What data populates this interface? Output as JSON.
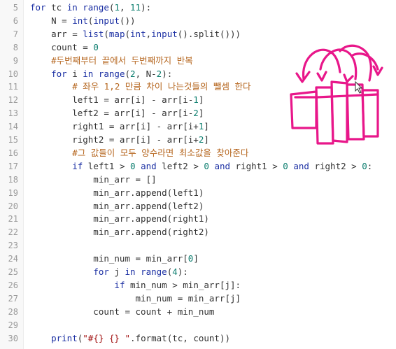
{
  "editor": {
    "language": "python",
    "accent_colors": {
      "keyword": "#1b2fa3",
      "number": "#0b7d6e",
      "string": "#a31515",
      "comment": "#b5651d",
      "annotation_ink": "#e8178a"
    },
    "lines": [
      {
        "n": "5",
        "tokens": [
          [
            "kw",
            "for"
          ],
          [
            "op",
            " tc "
          ],
          [
            "kw",
            "in"
          ],
          [
            "op",
            " "
          ],
          [
            "bi",
            "range"
          ],
          [
            "op",
            "("
          ],
          [
            "num",
            "1"
          ],
          [
            "op",
            ", "
          ],
          [
            "num",
            "11"
          ],
          [
            "op",
            "):"
          ]
        ]
      },
      {
        "n": "6",
        "tokens": [
          [
            "op",
            "    N = "
          ],
          [
            "bi",
            "int"
          ],
          [
            "op",
            "("
          ],
          [
            "bi",
            "input"
          ],
          [
            "op",
            "())"
          ]
        ]
      },
      {
        "n": "7",
        "tokens": [
          [
            "op",
            "    arr = "
          ],
          [
            "bi",
            "list"
          ],
          [
            "op",
            "("
          ],
          [
            "bi",
            "map"
          ],
          [
            "op",
            "("
          ],
          [
            "bi",
            "int"
          ],
          [
            "op",
            ","
          ],
          [
            "bi",
            "input"
          ],
          [
            "op",
            "().split()))"
          ]
        ]
      },
      {
        "n": "8",
        "tokens": [
          [
            "op",
            "    count = "
          ],
          [
            "num",
            "0"
          ]
        ]
      },
      {
        "n": "9",
        "tokens": [
          [
            "cm",
            "    #두번째부터 끝에서 두번째까지 반복"
          ]
        ]
      },
      {
        "n": "10",
        "tokens": [
          [
            "op",
            "    "
          ],
          [
            "kw",
            "for"
          ],
          [
            "op",
            " i "
          ],
          [
            "kw",
            "in"
          ],
          [
            "op",
            " "
          ],
          [
            "bi",
            "range"
          ],
          [
            "op",
            "("
          ],
          [
            "num",
            "2"
          ],
          [
            "op",
            ", N-"
          ],
          [
            "num",
            "2"
          ],
          [
            "op",
            "):"
          ]
        ]
      },
      {
        "n": "11",
        "tokens": [
          [
            "cm",
            "        # 좌우 1,2 만큼 차이 나는것들의 뺄셈 한다"
          ]
        ]
      },
      {
        "n": "12",
        "tokens": [
          [
            "op",
            "        left1 = arr[i] - arr[i-"
          ],
          [
            "num",
            "1"
          ],
          [
            "op",
            "]"
          ]
        ]
      },
      {
        "n": "13",
        "tokens": [
          [
            "op",
            "        left2 = arr[i] - arr[i-"
          ],
          [
            "num",
            "2"
          ],
          [
            "op",
            "]"
          ]
        ]
      },
      {
        "n": "14",
        "tokens": [
          [
            "op",
            "        right1 = arr[i] - arr[i+"
          ],
          [
            "num",
            "1"
          ],
          [
            "op",
            "]"
          ]
        ]
      },
      {
        "n": "15",
        "tokens": [
          [
            "op",
            "        right2 = arr[i] - arr[i+"
          ],
          [
            "num",
            "2"
          ],
          [
            "op",
            "]"
          ]
        ]
      },
      {
        "n": "16",
        "tokens": [
          [
            "cm",
            "        #그 값들이 모두 양수라면 최소값을 찾아준다"
          ]
        ]
      },
      {
        "n": "17",
        "tokens": [
          [
            "op",
            "        "
          ],
          [
            "kw",
            "if"
          ],
          [
            "op",
            " left1 > "
          ],
          [
            "num",
            "0"
          ],
          [
            "op",
            " "
          ],
          [
            "kw",
            "and"
          ],
          [
            "op",
            " left2 > "
          ],
          [
            "num",
            "0"
          ],
          [
            "op",
            " "
          ],
          [
            "kw",
            "and"
          ],
          [
            "op",
            " right1 > "
          ],
          [
            "num",
            "0"
          ],
          [
            "op",
            " "
          ],
          [
            "kw",
            "and"
          ],
          [
            "op",
            " right2 > "
          ],
          [
            "num",
            "0"
          ],
          [
            "op",
            ":"
          ]
        ]
      },
      {
        "n": "18",
        "tokens": [
          [
            "op",
            "            min_arr = []"
          ]
        ]
      },
      {
        "n": "19",
        "tokens": [
          [
            "op",
            "            min_arr.append(left1)"
          ]
        ]
      },
      {
        "n": "20",
        "tokens": [
          [
            "op",
            "            min_arr.append(left2)"
          ]
        ]
      },
      {
        "n": "21",
        "tokens": [
          [
            "op",
            "            min_arr.append(right1)"
          ]
        ]
      },
      {
        "n": "22",
        "tokens": [
          [
            "op",
            "            min_arr.append(right2)"
          ]
        ]
      },
      {
        "n": "23",
        "tokens": []
      },
      {
        "n": "24",
        "tokens": [
          [
            "op",
            "            min_num = min_arr["
          ],
          [
            "num",
            "0"
          ],
          [
            "op",
            "]"
          ]
        ]
      },
      {
        "n": "25",
        "tokens": [
          [
            "op",
            "            "
          ],
          [
            "kw",
            "for"
          ],
          [
            "op",
            " j "
          ],
          [
            "kw",
            "in"
          ],
          [
            "op",
            " "
          ],
          [
            "bi",
            "range"
          ],
          [
            "op",
            "("
          ],
          [
            "num",
            "4"
          ],
          [
            "op",
            "):"
          ]
        ]
      },
      {
        "n": "26",
        "tokens": [
          [
            "op",
            "                "
          ],
          [
            "kw",
            "if"
          ],
          [
            "op",
            " min_num > min_arr[j]:"
          ]
        ]
      },
      {
        "n": "27",
        "tokens": [
          [
            "op",
            "                    min_num = min_arr[j]"
          ]
        ]
      },
      {
        "n": "28",
        "tokens": [
          [
            "op",
            "            count = count + min_num"
          ]
        ]
      },
      {
        "n": "29",
        "tokens": []
      },
      {
        "n": "30",
        "tokens": [
          [
            "op",
            "    "
          ],
          [
            "bi",
            "print"
          ],
          [
            "op",
            "("
          ],
          [
            "str",
            "\"#{} {} \""
          ],
          [
            "op",
            ".format(tc, count))"
          ]
        ]
      }
    ]
  },
  "annotation": {
    "icon": "hand-drawn-bars-with-arrows-sketch"
  }
}
